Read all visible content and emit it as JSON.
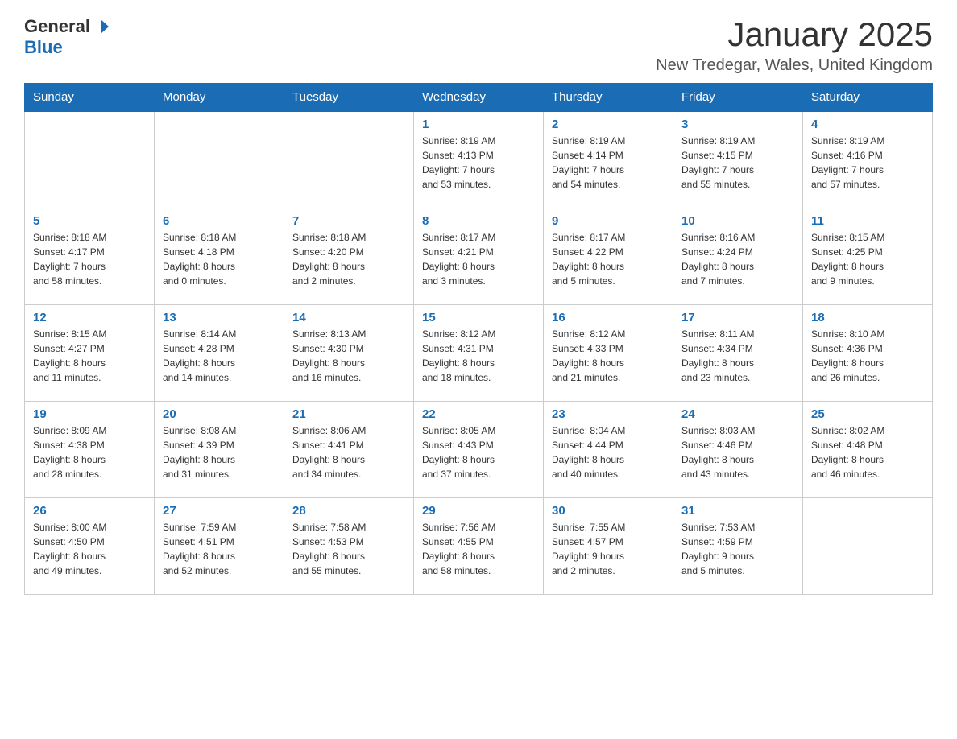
{
  "header": {
    "logo_general": "General",
    "logo_blue": "Blue",
    "month_title": "January 2025",
    "location": "New Tredegar, Wales, United Kingdom"
  },
  "days_of_week": [
    "Sunday",
    "Monday",
    "Tuesday",
    "Wednesday",
    "Thursday",
    "Friday",
    "Saturday"
  ],
  "weeks": [
    [
      {
        "day": "",
        "info": ""
      },
      {
        "day": "",
        "info": ""
      },
      {
        "day": "",
        "info": ""
      },
      {
        "day": "1",
        "info": "Sunrise: 8:19 AM\nSunset: 4:13 PM\nDaylight: 7 hours\nand 53 minutes."
      },
      {
        "day": "2",
        "info": "Sunrise: 8:19 AM\nSunset: 4:14 PM\nDaylight: 7 hours\nand 54 minutes."
      },
      {
        "day": "3",
        "info": "Sunrise: 8:19 AM\nSunset: 4:15 PM\nDaylight: 7 hours\nand 55 minutes."
      },
      {
        "day": "4",
        "info": "Sunrise: 8:19 AM\nSunset: 4:16 PM\nDaylight: 7 hours\nand 57 minutes."
      }
    ],
    [
      {
        "day": "5",
        "info": "Sunrise: 8:18 AM\nSunset: 4:17 PM\nDaylight: 7 hours\nand 58 minutes."
      },
      {
        "day": "6",
        "info": "Sunrise: 8:18 AM\nSunset: 4:18 PM\nDaylight: 8 hours\nand 0 minutes."
      },
      {
        "day": "7",
        "info": "Sunrise: 8:18 AM\nSunset: 4:20 PM\nDaylight: 8 hours\nand 2 minutes."
      },
      {
        "day": "8",
        "info": "Sunrise: 8:17 AM\nSunset: 4:21 PM\nDaylight: 8 hours\nand 3 minutes."
      },
      {
        "day": "9",
        "info": "Sunrise: 8:17 AM\nSunset: 4:22 PM\nDaylight: 8 hours\nand 5 minutes."
      },
      {
        "day": "10",
        "info": "Sunrise: 8:16 AM\nSunset: 4:24 PM\nDaylight: 8 hours\nand 7 minutes."
      },
      {
        "day": "11",
        "info": "Sunrise: 8:15 AM\nSunset: 4:25 PM\nDaylight: 8 hours\nand 9 minutes."
      }
    ],
    [
      {
        "day": "12",
        "info": "Sunrise: 8:15 AM\nSunset: 4:27 PM\nDaylight: 8 hours\nand 11 minutes."
      },
      {
        "day": "13",
        "info": "Sunrise: 8:14 AM\nSunset: 4:28 PM\nDaylight: 8 hours\nand 14 minutes."
      },
      {
        "day": "14",
        "info": "Sunrise: 8:13 AM\nSunset: 4:30 PM\nDaylight: 8 hours\nand 16 minutes."
      },
      {
        "day": "15",
        "info": "Sunrise: 8:12 AM\nSunset: 4:31 PM\nDaylight: 8 hours\nand 18 minutes."
      },
      {
        "day": "16",
        "info": "Sunrise: 8:12 AM\nSunset: 4:33 PM\nDaylight: 8 hours\nand 21 minutes."
      },
      {
        "day": "17",
        "info": "Sunrise: 8:11 AM\nSunset: 4:34 PM\nDaylight: 8 hours\nand 23 minutes."
      },
      {
        "day": "18",
        "info": "Sunrise: 8:10 AM\nSunset: 4:36 PM\nDaylight: 8 hours\nand 26 minutes."
      }
    ],
    [
      {
        "day": "19",
        "info": "Sunrise: 8:09 AM\nSunset: 4:38 PM\nDaylight: 8 hours\nand 28 minutes."
      },
      {
        "day": "20",
        "info": "Sunrise: 8:08 AM\nSunset: 4:39 PM\nDaylight: 8 hours\nand 31 minutes."
      },
      {
        "day": "21",
        "info": "Sunrise: 8:06 AM\nSunset: 4:41 PM\nDaylight: 8 hours\nand 34 minutes."
      },
      {
        "day": "22",
        "info": "Sunrise: 8:05 AM\nSunset: 4:43 PM\nDaylight: 8 hours\nand 37 minutes."
      },
      {
        "day": "23",
        "info": "Sunrise: 8:04 AM\nSunset: 4:44 PM\nDaylight: 8 hours\nand 40 minutes."
      },
      {
        "day": "24",
        "info": "Sunrise: 8:03 AM\nSunset: 4:46 PM\nDaylight: 8 hours\nand 43 minutes."
      },
      {
        "day": "25",
        "info": "Sunrise: 8:02 AM\nSunset: 4:48 PM\nDaylight: 8 hours\nand 46 minutes."
      }
    ],
    [
      {
        "day": "26",
        "info": "Sunrise: 8:00 AM\nSunset: 4:50 PM\nDaylight: 8 hours\nand 49 minutes."
      },
      {
        "day": "27",
        "info": "Sunrise: 7:59 AM\nSunset: 4:51 PM\nDaylight: 8 hours\nand 52 minutes."
      },
      {
        "day": "28",
        "info": "Sunrise: 7:58 AM\nSunset: 4:53 PM\nDaylight: 8 hours\nand 55 minutes."
      },
      {
        "day": "29",
        "info": "Sunrise: 7:56 AM\nSunset: 4:55 PM\nDaylight: 8 hours\nand 58 minutes."
      },
      {
        "day": "30",
        "info": "Sunrise: 7:55 AM\nSunset: 4:57 PM\nDaylight: 9 hours\nand 2 minutes."
      },
      {
        "day": "31",
        "info": "Sunrise: 7:53 AM\nSunset: 4:59 PM\nDaylight: 9 hours\nand 5 minutes."
      },
      {
        "day": "",
        "info": ""
      }
    ]
  ]
}
